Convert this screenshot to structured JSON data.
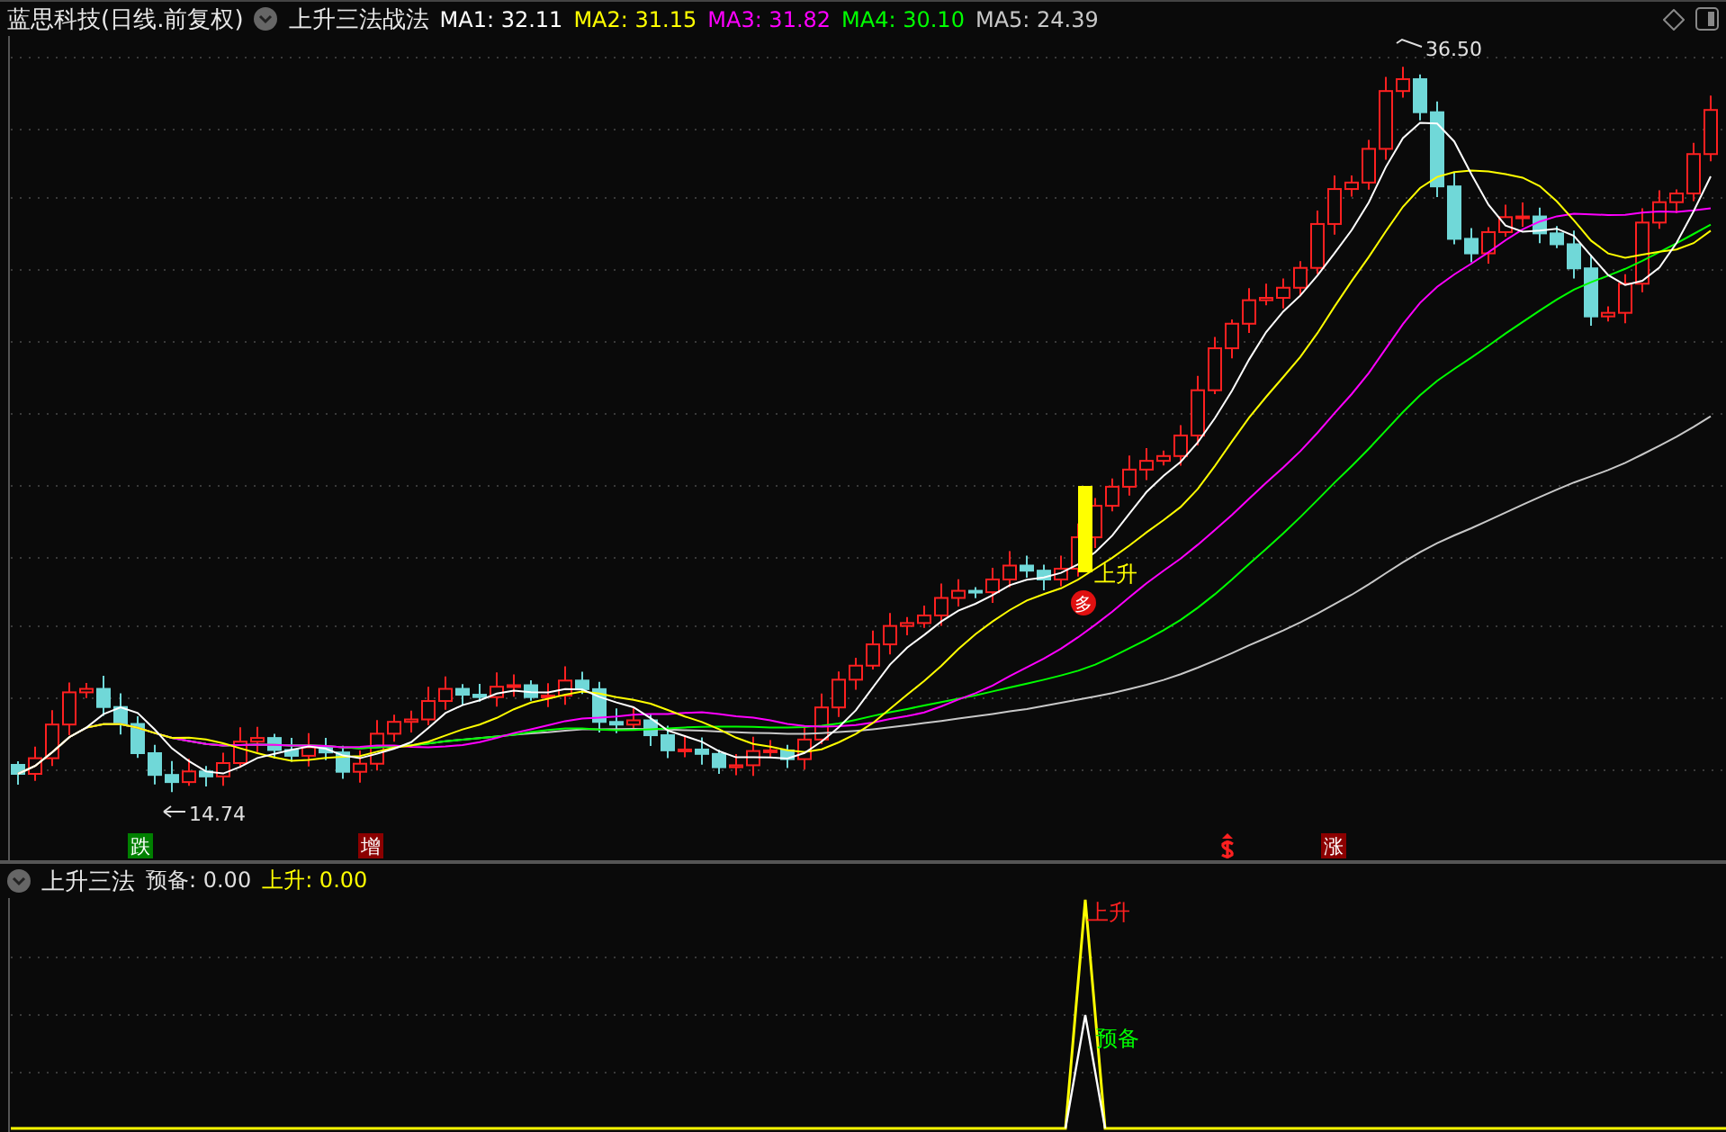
{
  "main_panel": {
    "title": "蓝思科技(日线.前复权)",
    "indicator": "上升三法战法",
    "moving_averages": [
      {
        "label": "MA1: 32.11",
        "color": "#ffffff"
      },
      {
        "label": "MA2: 31.15",
        "color": "#ffff00"
      },
      {
        "label": "MA3: 31.82",
        "color": "#ff00ff"
      },
      {
        "label": "MA4: 30.10",
        "color": "#00ff00"
      },
      {
        "label": "MA5: 24.39",
        "color": "#c8c8c8"
      }
    ],
    "high_label": "36.50",
    "low_label": "14.74",
    "signal_label": "上升",
    "signal_badge": "多",
    "markers": [
      {
        "text": "跌",
        "color": "#008000"
      },
      {
        "text": "增",
        "color": "#8b0000"
      },
      {
        "text": "涨",
        "color": "#8b0000"
      }
    ]
  },
  "lower_panel": {
    "indicator": "上升三法",
    "values": [
      {
        "label": "预备: 0.00",
        "color": "#e0e0e0"
      },
      {
        "label": "上升: 0.00",
        "color": "#ffff00"
      }
    ],
    "peak_labels": [
      {
        "text": "上升",
        "color": "#ff2020"
      },
      {
        "text": "预备",
        "color": "#00ff00"
      }
    ]
  }
}
